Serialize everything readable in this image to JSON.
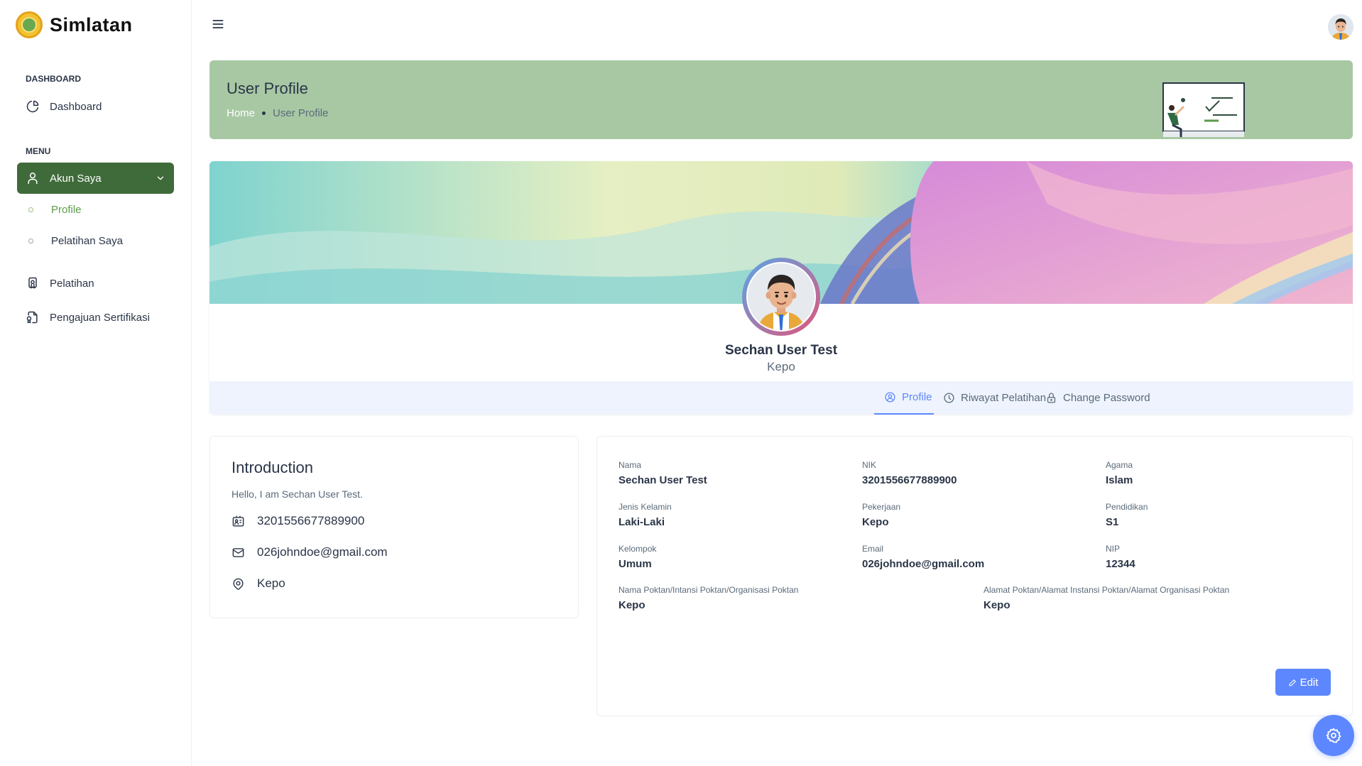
{
  "app": {
    "name": "Simlatan"
  },
  "sidebar": {
    "sections": [
      {
        "caption": "DASHBOARD",
        "items": [
          {
            "label": "Dashboard",
            "icon": "pie-chart-icon"
          }
        ]
      },
      {
        "caption": "MENU",
        "items": [
          {
            "label": "Akun Saya",
            "icon": "user-icon",
            "active": true,
            "expanded": true,
            "children": [
              {
                "label": "Profile",
                "active": true
              },
              {
                "label": "Pelatihan Saya"
              }
            ]
          },
          {
            "label": "Pelatihan",
            "icon": "certificate-icon"
          },
          {
            "label": "Pengajuan Sertifikasi",
            "icon": "file-certificate-icon"
          }
        ]
      }
    ]
  },
  "header": {
    "title": "User Profile",
    "breadcrumb": [
      "Home",
      "User Profile"
    ]
  },
  "profile": {
    "name": "Sechan User Test",
    "role": "Kepo",
    "tabs": [
      {
        "label": "Profile",
        "icon": "user-circle-icon",
        "active": true
      },
      {
        "label": "Riwayat Pelatihan",
        "icon": "clock-icon"
      },
      {
        "label": "Change Password",
        "icon": "lock-icon"
      }
    ]
  },
  "intro": {
    "title": "Introduction",
    "hello": "Hello, I am Sechan User Test.",
    "nik": "3201556677889900",
    "email": "026johndoe@gmail.com",
    "location": "Kepo"
  },
  "details": {
    "nama": {
      "label": "Nama",
      "value": "Sechan User Test"
    },
    "nik": {
      "label": "NIK",
      "value": "3201556677889900"
    },
    "agama": {
      "label": "Agama",
      "value": "Islam"
    },
    "jenis_kelamin": {
      "label": "Jenis Kelamin",
      "value": "Laki-Laki"
    },
    "pekerjaan": {
      "label": "Pekerjaan",
      "value": "Kepo"
    },
    "pendidikan": {
      "label": "Pendidikan",
      "value": "S1"
    },
    "kelompok": {
      "label": "Kelompok",
      "value": "Umum"
    },
    "email": {
      "label": "Email",
      "value": "026johndoe@gmail.com"
    },
    "nip": {
      "label": "NIP",
      "value": "12344"
    },
    "nama_poktan": {
      "label": "Nama Poktan/Intansi Poktan/Organisasi Poktan",
      "value": "Kepo"
    },
    "alamat_poktan": {
      "label": "Alamat Poktan/Alamat Instansi Poktan/Alamat Organisasi Poktan",
      "value": "Kepo"
    },
    "edit_label": "Edit"
  },
  "colors": {
    "sidebar_active": "#3f6b3a",
    "header_bg": "#a8c8a4",
    "accent": "#5d87ff",
    "tabbar_bg": "#eef3fd"
  }
}
